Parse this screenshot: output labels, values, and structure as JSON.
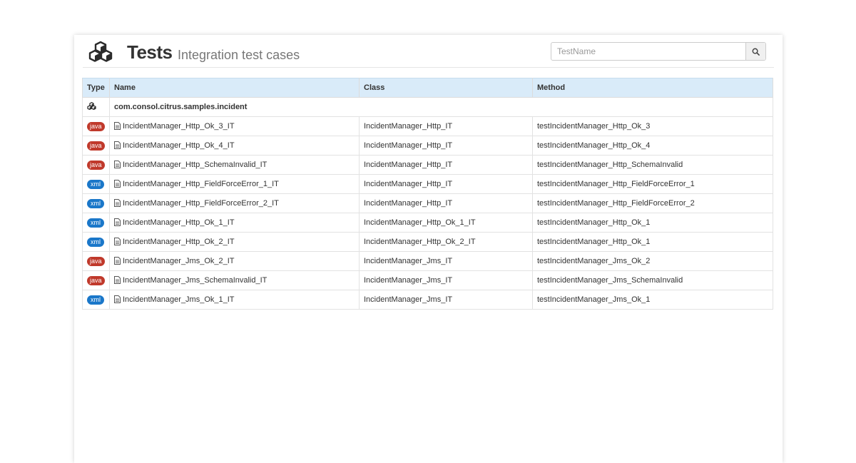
{
  "header": {
    "title": "Tests",
    "subtitle": "Integration test cases",
    "search_placeholder": "TestName"
  },
  "table": {
    "columns": [
      "Type",
      "Name",
      "Class",
      "Method"
    ],
    "package": "com.consol.citrus.samples.incident",
    "rows": [
      {
        "type": "java",
        "name": "IncidentManager_Http_Ok_3_IT",
        "class": "IncidentManager_Http_IT",
        "method": "testIncidentManager_Http_Ok_3"
      },
      {
        "type": "java",
        "name": "IncidentManager_Http_Ok_4_IT",
        "class": "IncidentManager_Http_IT",
        "method": "testIncidentManager_Http_Ok_4"
      },
      {
        "type": "java",
        "name": "IncidentManager_Http_SchemaInvalid_IT",
        "class": "IncidentManager_Http_IT",
        "method": "testIncidentManager_Http_SchemaInvalid"
      },
      {
        "type": "xml",
        "name": "IncidentManager_Http_FieldForceError_1_IT",
        "class": "IncidentManager_Http_IT",
        "method": "testIncidentManager_Http_FieldForceError_1"
      },
      {
        "type": "xml",
        "name": "IncidentManager_Http_FieldForceError_2_IT",
        "class": "IncidentManager_Http_IT",
        "method": "testIncidentManager_Http_FieldForceError_2"
      },
      {
        "type": "xml",
        "name": "IncidentManager_Http_Ok_1_IT",
        "class": "IncidentManager_Http_Ok_1_IT",
        "method": "testIncidentManager_Http_Ok_1"
      },
      {
        "type": "xml",
        "name": "IncidentManager_Http_Ok_2_IT",
        "class": "IncidentManager_Http_Ok_2_IT",
        "method": "testIncidentManager_Http_Ok_1"
      },
      {
        "type": "java",
        "name": "IncidentManager_Jms_Ok_2_IT",
        "class": "IncidentManager_Jms_IT",
        "method": "testIncidentManager_Jms_Ok_2"
      },
      {
        "type": "java",
        "name": "IncidentManager_Jms_SchemaInvalid_IT",
        "class": "IncidentManager_Jms_IT",
        "method": "testIncidentManager_Jms_SchemaInvalid"
      },
      {
        "type": "xml",
        "name": "IncidentManager_Jms_Ok_1_IT",
        "class": "IncidentManager_Jms_IT",
        "method": "testIncidentManager_Jms_Ok_1"
      }
    ]
  },
  "colors": {
    "java_badge": "#c0392b",
    "xml_badge": "#1a77c9",
    "table_header": "#d9ebf9"
  },
  "icons": {
    "logo": "cubes-icon",
    "search": "search-icon",
    "package": "cubes-icon",
    "test_file": "file-icon"
  }
}
